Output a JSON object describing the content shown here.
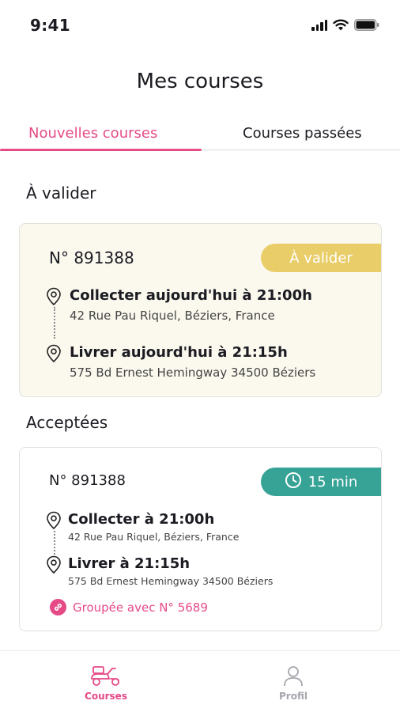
{
  "status_bar": {
    "time": "9:41"
  },
  "header": {
    "title": "Mes courses"
  },
  "tabs": [
    {
      "label": "Nouvelles courses",
      "active": true
    },
    {
      "label": "Courses passées",
      "active": false
    }
  ],
  "sections": {
    "pending": {
      "title": "À valider",
      "card": {
        "order_number": "N° 891388",
        "badge": "À valider",
        "pickup": {
          "title": "Collecter aujourd'hui à 21:00h",
          "address": "42 Rue Pau Riquel, Béziers, France"
        },
        "delivery": {
          "title": "Livrer aujourd'hui à 21:15h",
          "address": "575 Bd Ernest Hemingway 34500 Béziers"
        }
      }
    },
    "accepted": {
      "title": "Acceptées",
      "card": {
        "order_number": "N° 891388",
        "timer": "15 min",
        "pickup": {
          "title": "Collecter à 21:00h",
          "address": "42 Rue Pau Riquel, Béziers, France"
        },
        "delivery": {
          "title": "Livrer à 21:15h",
          "address": "575 Bd Ernest Hemingway 34500 Béziers"
        },
        "grouped": "Groupée avec N° 5689"
      }
    }
  },
  "bottom_nav": [
    {
      "label": "Courses",
      "icon": "scooter-icon",
      "active": true
    },
    {
      "label": "Profil",
      "icon": "user-icon",
      "active": false
    }
  ],
  "colors": {
    "accent": "#e54a87",
    "pending_badge": "#e8cd69",
    "timer_badge": "#36a396",
    "pending_card_bg": "#fbf8ee"
  }
}
